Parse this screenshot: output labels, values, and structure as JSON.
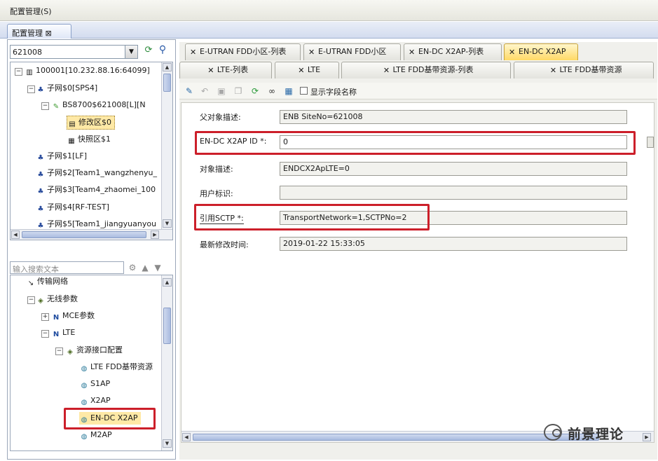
{
  "menu": {
    "title": "配置管理(S)"
  },
  "dock": {
    "tab_label": "配置管理 ⊠"
  },
  "left": {
    "combo_value": "621008",
    "tree1": [
      {
        "label": "100001[10.232.88.16:64099]",
        "icon": "computer-icon"
      },
      {
        "label": "子网$0[SPS4]",
        "icon": "network-icon"
      },
      {
        "label": "BS8700$621008[L][N",
        "icon": "base-station-icon"
      },
      {
        "label": "修改区$0",
        "icon": "modify-area-icon"
      },
      {
        "label": "快照区$1",
        "icon": "snapshot-icon"
      },
      {
        "label": "子网$1[LF]",
        "icon": "network-icon"
      },
      {
        "label": "子网$2[Team1_wangzhenyu_",
        "icon": "network-icon"
      },
      {
        "label": "子网$3[Team4_zhaomei_100",
        "icon": "network-icon"
      },
      {
        "label": "子网$4[RF-TEST]",
        "icon": "network-icon"
      },
      {
        "label": "子网$5[Team1_jiangyuanyou",
        "icon": "network-icon"
      }
    ],
    "search_placeholder": "输入搜索文本",
    "tree2": [
      {
        "label": "传输网络",
        "icon": "transport-icon"
      },
      {
        "label": "无线参数",
        "icon": "wireless-icon"
      },
      {
        "label": "MCE参数",
        "icon": "mce-icon"
      },
      {
        "label": "LTE",
        "icon": "lte-icon"
      },
      {
        "label": "资源接口配置",
        "icon": "resource-icon"
      },
      {
        "label": "LTE FDD基带资源",
        "icon": "globe-icon"
      },
      {
        "label": "S1AP",
        "icon": "globe-icon"
      },
      {
        "label": "X2AP",
        "icon": "globe-icon"
      },
      {
        "label": "EN-DC X2AP",
        "icon": "globe-icon"
      },
      {
        "label": "M2AP",
        "icon": "globe-icon"
      }
    ]
  },
  "tabs_top": [
    {
      "label": "E-UTRAN FDD小区-列表"
    },
    {
      "label": "E-UTRAN FDD小区"
    },
    {
      "label": "EN-DC X2AP-列表"
    },
    {
      "label": "EN-DC X2AP",
      "active": true
    }
  ],
  "tabs_second": [
    {
      "label": "LTE-列表"
    },
    {
      "label": "LTE"
    },
    {
      "label": "LTE FDD基带资源-列表"
    },
    {
      "label": "LTE FDD基带资源"
    }
  ],
  "toolbar": {
    "show_field_name": "显示字段名称"
  },
  "form": [
    {
      "label": "父对象描述:",
      "value": "ENB SiteNo=621008"
    },
    {
      "label": "EN-DC X2AP ID *:",
      "value": "0"
    },
    {
      "label": "对象描述:",
      "value": "ENDCX2ApLTE=0"
    },
    {
      "label": "用户标识:",
      "value": ""
    },
    {
      "label": "引用SCTP *:",
      "value": "TransportNetwork=1,SCTPNo=2"
    },
    {
      "label": "最新修改时间:",
      "value": "2019-01-22 15:33:05"
    }
  ],
  "watermark": {
    "text": "前景理论"
  },
  "colors": {
    "highlight_red": "#cc1f2a",
    "active_tab": "#ffd966"
  }
}
